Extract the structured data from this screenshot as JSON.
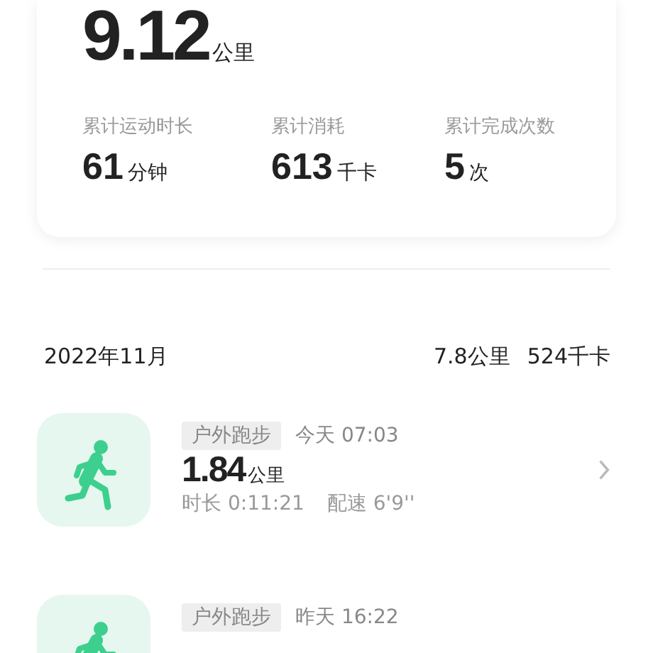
{
  "summary": {
    "total": {
      "value": "9.12",
      "unit": "公里"
    },
    "stats": [
      {
        "label": "累计运动时长",
        "value": "61",
        "unit": "分钟"
      },
      {
        "label": "累计消耗",
        "value": "613",
        "unit": "千卡"
      },
      {
        "label": "累计完成次数",
        "value": "5",
        "unit": "次"
      }
    ]
  },
  "month": {
    "title": "2022年11月",
    "distance": "7.8公里",
    "calories": "524千卡"
  },
  "records": [
    {
      "tag": "户外跑步",
      "time": "今天 07:03",
      "distance": "1.84",
      "unit": "公里",
      "duration": "时长 0:11:21",
      "pace": "配速 6'9''"
    },
    {
      "tag": "户外跑步",
      "time": "昨天 16:22"
    }
  ]
}
